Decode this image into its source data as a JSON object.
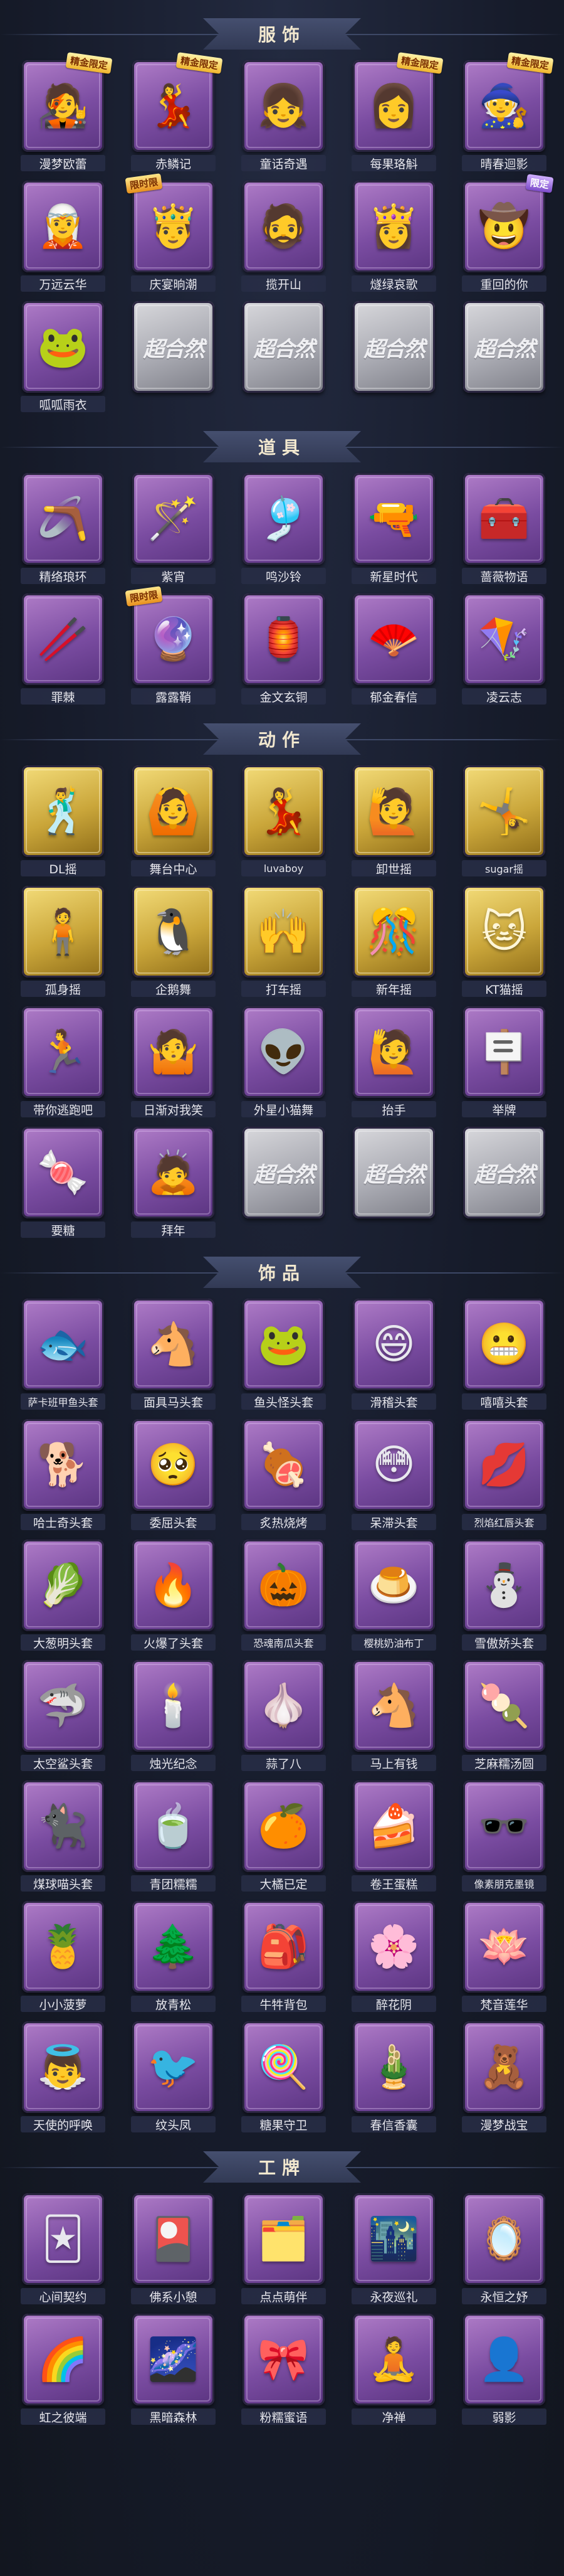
{
  "sections": [
    {
      "title": "服饰",
      "items": [
        {
          "label": "漫梦欧蕾",
          "icon": "🧑‍🎤",
          "frame": "purple",
          "badge": "精金限定"
        },
        {
          "label": "赤鳞记",
          "icon": "💃",
          "frame": "purple",
          "badge": "精金限定"
        },
        {
          "label": "童话奇遇",
          "icon": "👧",
          "frame": "purple",
          "badge": ""
        },
        {
          "label": "每果珞斛",
          "icon": "👩",
          "frame": "purple",
          "badge": "精金限定"
        },
        {
          "label": "晴春迴影",
          "icon": "🧙",
          "frame": "purple",
          "badge": "精金限定"
        },
        {
          "label": "万远云华",
          "icon": "🧝",
          "frame": "purple",
          "badge": ""
        },
        {
          "label": "庆宴晌潮",
          "icon": "🤴",
          "frame": "purple",
          "badge": "限时限"
        },
        {
          "label": "揽开山",
          "icon": "🧔",
          "frame": "purple",
          "badge": ""
        },
        {
          "label": "燧绿哀歌",
          "icon": "👸",
          "frame": "purple",
          "badge": ""
        },
        {
          "label": "重回的你",
          "icon": "🤠",
          "frame": "purple",
          "badge": "限定"
        },
        {
          "label": "呱呱雨衣",
          "icon": "🐸",
          "frame": "purple",
          "badge": ""
        },
        {
          "label": "",
          "icon": "",
          "frame": "blank",
          "badge": ""
        },
        {
          "label": "",
          "icon": "",
          "frame": "blank",
          "badge": ""
        },
        {
          "label": "",
          "icon": "",
          "frame": "blank",
          "badge": ""
        },
        {
          "label": "",
          "icon": "",
          "frame": "blank",
          "badge": ""
        }
      ]
    },
    {
      "title": "道具",
      "items": [
        {
          "label": "精络琅环",
          "icon": "🪃",
          "frame": "purple",
          "badge": ""
        },
        {
          "label": "紫宵",
          "icon": "🪄",
          "frame": "purple",
          "badge": ""
        },
        {
          "label": "鸣沙铃",
          "icon": "🎐",
          "frame": "purple",
          "badge": ""
        },
        {
          "label": "新星时代",
          "icon": "🔫",
          "frame": "purple",
          "badge": ""
        },
        {
          "label": "蔷薇物语",
          "icon": "🧰",
          "frame": "purple",
          "badge": ""
        },
        {
          "label": "罪棘",
          "icon": "🥢",
          "frame": "purple",
          "badge": ""
        },
        {
          "label": "露露鞘",
          "icon": "🔮",
          "frame": "purple",
          "badge": "限时限"
        },
        {
          "label": "金文玄铜",
          "icon": "🏮",
          "frame": "purple",
          "badge": ""
        },
        {
          "label": "郁金春信",
          "icon": "🪭",
          "frame": "purple",
          "badge": ""
        },
        {
          "label": "凌云志",
          "icon": "🪁",
          "frame": "purple",
          "badge": ""
        }
      ]
    },
    {
      "title": "动作",
      "items": [
        {
          "label": "DL摇",
          "icon": "🕺",
          "frame": "gold",
          "badge": ""
        },
        {
          "label": "舞台中心",
          "icon": "🙆",
          "frame": "gold",
          "badge": ""
        },
        {
          "label": "luvaboy",
          "icon": "💃",
          "frame": "gold",
          "badge": ""
        },
        {
          "label": "卸世摇",
          "icon": "🙋",
          "frame": "gold",
          "badge": ""
        },
        {
          "label": "sugar摇",
          "icon": "🤸",
          "frame": "gold",
          "badge": ""
        },
        {
          "label": "孤身摇",
          "icon": "🧍",
          "frame": "gold",
          "badge": ""
        },
        {
          "label": "企鹅舞",
          "icon": "🐧",
          "frame": "gold",
          "badge": ""
        },
        {
          "label": "打车摇",
          "icon": "🙌",
          "frame": "gold",
          "badge": ""
        },
        {
          "label": "新年摇",
          "icon": "🎊",
          "frame": "gold",
          "badge": ""
        },
        {
          "label": "KT猫摇",
          "icon": "🐱",
          "frame": "gold",
          "badge": ""
        },
        {
          "label": "带你逃跑吧",
          "icon": "🏃",
          "frame": "purple",
          "badge": ""
        },
        {
          "label": "日渐对我笑",
          "icon": "🤷",
          "frame": "purple",
          "badge": ""
        },
        {
          "label": "外星小猫舞",
          "icon": "👽",
          "frame": "purple",
          "badge": ""
        },
        {
          "label": "抬手",
          "icon": "🙋",
          "frame": "purple",
          "badge": ""
        },
        {
          "label": "举牌",
          "icon": "🪧",
          "frame": "purple",
          "badge": ""
        },
        {
          "label": "要糖",
          "icon": "🍬",
          "frame": "purple",
          "badge": ""
        },
        {
          "label": "拜年",
          "icon": "🙇",
          "frame": "purple",
          "badge": ""
        },
        {
          "label": "",
          "icon": "",
          "frame": "blank",
          "badge": ""
        },
        {
          "label": "",
          "icon": "",
          "frame": "blank",
          "badge": ""
        },
        {
          "label": "",
          "icon": "",
          "frame": "blank",
          "badge": ""
        }
      ]
    },
    {
      "title": "饰品",
      "items": [
        {
          "label": "萨卡班甲鱼头套",
          "icon": "🐟",
          "frame": "purple",
          "badge": ""
        },
        {
          "label": "面具马头套",
          "icon": "🐴",
          "frame": "purple",
          "badge": ""
        },
        {
          "label": "鱼头怪头套",
          "icon": "🐸",
          "frame": "purple",
          "badge": ""
        },
        {
          "label": "滑稽头套",
          "icon": "😄",
          "frame": "purple",
          "badge": ""
        },
        {
          "label": "嘻嘻头套",
          "icon": "😬",
          "frame": "purple",
          "badge": ""
        },
        {
          "label": "哈士奇头套",
          "icon": "🐕",
          "frame": "purple",
          "badge": ""
        },
        {
          "label": "委屈头套",
          "icon": "🥺",
          "frame": "purple",
          "badge": ""
        },
        {
          "label": "炙热烧烤",
          "icon": "🍖",
          "frame": "purple",
          "badge": ""
        },
        {
          "label": "呆滞头套",
          "icon": "😳",
          "frame": "purple",
          "badge": ""
        },
        {
          "label": "烈焰红唇头套",
          "icon": "💋",
          "frame": "purple",
          "badge": ""
        },
        {
          "label": "大葱明头套",
          "icon": "🥬",
          "frame": "purple",
          "badge": ""
        },
        {
          "label": "火爆了头套",
          "icon": "🔥",
          "frame": "purple",
          "badge": ""
        },
        {
          "label": "恐魂南瓜头套",
          "icon": "🎃",
          "frame": "purple",
          "badge": ""
        },
        {
          "label": "樱桃奶油布丁",
          "icon": "🍮",
          "frame": "purple",
          "badge": ""
        },
        {
          "label": "雪傲娇头套",
          "icon": "⛄",
          "frame": "purple",
          "badge": ""
        },
        {
          "label": "太空鲨头套",
          "icon": "🦈",
          "frame": "purple",
          "badge": ""
        },
        {
          "label": "烛光纪念",
          "icon": "🕯️",
          "frame": "purple",
          "badge": ""
        },
        {
          "label": "蒜了八",
          "icon": "🧄",
          "frame": "purple",
          "badge": ""
        },
        {
          "label": "马上有钱",
          "icon": "🐴",
          "frame": "purple",
          "badge": ""
        },
        {
          "label": "芝麻糯汤圆",
          "icon": "🍡",
          "frame": "purple",
          "badge": ""
        },
        {
          "label": "煤球喵头套",
          "icon": "🐈‍⬛",
          "frame": "purple",
          "badge": ""
        },
        {
          "label": "青团糯糯",
          "icon": "🍵",
          "frame": "purple",
          "badge": ""
        },
        {
          "label": "大橘已定",
          "icon": "🍊",
          "frame": "purple",
          "badge": ""
        },
        {
          "label": "卷王蛋糕",
          "icon": "🍰",
          "frame": "purple",
          "badge": ""
        },
        {
          "label": "像素朋克墨镜",
          "icon": "🕶️",
          "frame": "purple",
          "badge": ""
        },
        {
          "label": "小小菠萝",
          "icon": "🍍",
          "frame": "purple",
          "badge": ""
        },
        {
          "label": "放青松",
          "icon": "🌲",
          "frame": "purple",
          "badge": ""
        },
        {
          "label": "牛牪背包",
          "icon": "🎒",
          "frame": "purple",
          "badge": ""
        },
        {
          "label": "醉花阴",
          "icon": "🌸",
          "frame": "purple",
          "badge": ""
        },
        {
          "label": "梵音莲华",
          "icon": "🪷",
          "frame": "purple",
          "badge": ""
        },
        {
          "label": "天使的呼唤",
          "icon": "👼",
          "frame": "purple",
          "badge": ""
        },
        {
          "label": "纹头凤",
          "icon": "🐦",
          "frame": "purple",
          "badge": ""
        },
        {
          "label": "糖果守卫",
          "icon": "🍭",
          "frame": "purple",
          "badge": ""
        },
        {
          "label": "春信香囊",
          "icon": "🎍",
          "frame": "purple",
          "badge": ""
        },
        {
          "label": "漫梦战宝",
          "icon": "🧸",
          "frame": "purple",
          "badge": ""
        }
      ]
    },
    {
      "title": "工牌",
      "items": [
        {
          "label": "心间契约",
          "icon": "🃏",
          "frame": "purple",
          "badge": ""
        },
        {
          "label": "佛系小憩",
          "icon": "🎴",
          "frame": "purple",
          "badge": ""
        },
        {
          "label": "点点萌伴",
          "icon": "🗂️",
          "frame": "purple",
          "badge": ""
        },
        {
          "label": "永夜巡礼",
          "icon": "🌃",
          "frame": "purple",
          "badge": ""
        },
        {
          "label": "永恒之妤",
          "icon": "🪞",
          "frame": "purple",
          "badge": ""
        },
        {
          "label": "虹之彼端",
          "icon": "🌈",
          "frame": "purple",
          "badge": ""
        },
        {
          "label": "黑暗森林",
          "icon": "🌌",
          "frame": "purple",
          "badge": ""
        },
        {
          "label": "粉糯蜜语",
          "icon": "🎀",
          "frame": "purple",
          "badge": ""
        },
        {
          "label": "净禅",
          "icon": "🧘",
          "frame": "purple",
          "badge": ""
        },
        {
          "label": "弱影",
          "icon": "👤",
          "frame": "purple",
          "badge": ""
        }
      ]
    }
  ],
  "blank_watermark": "超合然"
}
